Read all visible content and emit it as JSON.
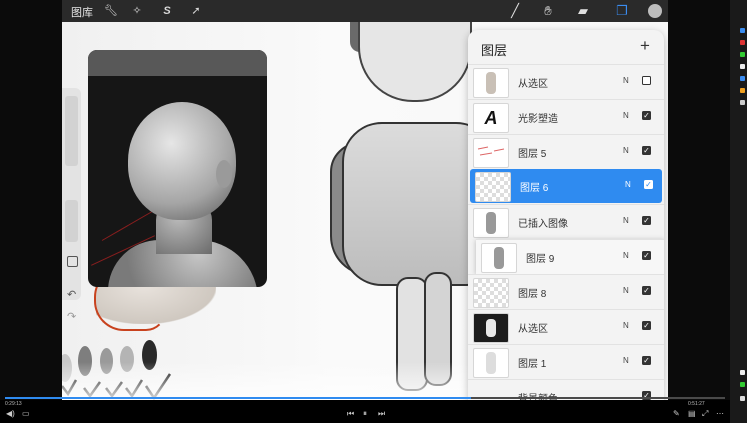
{
  "toolbar": {
    "gallery_label": "图库",
    "left_icons": [
      "wrench-icon",
      "magic-wand-icon",
      "selection-icon",
      "arrow-icon"
    ],
    "right_icons": [
      "brush-icon",
      "smudge-icon",
      "eraser-icon",
      "layers-icon",
      "color-swatch-icon"
    ]
  },
  "layers_panel": {
    "title": "图层",
    "add_label": "+",
    "layers": [
      {
        "name": "从选区",
        "blend": "N",
        "visible": false,
        "thumb": "figure"
      },
      {
        "name": "光影塑造",
        "blend": "N",
        "visible": true,
        "thumb": "letter",
        "thumb_letter": "A"
      },
      {
        "name": "图层 5",
        "blend": "N",
        "visible": true,
        "thumb": "sketch"
      },
      {
        "name": "图层 6",
        "blend": "N",
        "visible": true,
        "thumb": "checker",
        "selected": true
      },
      {
        "name": "已插入图像",
        "blend": "N",
        "visible": true,
        "thumb": "figure-gray"
      },
      {
        "name": "图层 9",
        "blend": "N",
        "visible": true,
        "thumb": "figure-gray",
        "dragging": true
      },
      {
        "name": "图层 8",
        "blend": "N",
        "visible": true,
        "thumb": "checker"
      },
      {
        "name": "从选区",
        "blend": "N",
        "visible": true,
        "thumb": "dark"
      },
      {
        "name": "图层 1",
        "blend": "N",
        "visible": true,
        "thumb": "figure-white"
      },
      {
        "name": "背景颜色",
        "blend": "",
        "visible": true,
        "thumb": "none"
      }
    ]
  },
  "colors": {
    "accent": "#2f8bf0",
    "sketch_red": "#c8421e",
    "swatches": [
      "#c9c9c9",
      "#7e7e7e",
      "#9a9a9a",
      "#b4b4b4",
      "#2a2a2a"
    ]
  },
  "player": {
    "time_left": "0:29:13",
    "time_right": "0:51:27",
    "progress": 0.647
  }
}
